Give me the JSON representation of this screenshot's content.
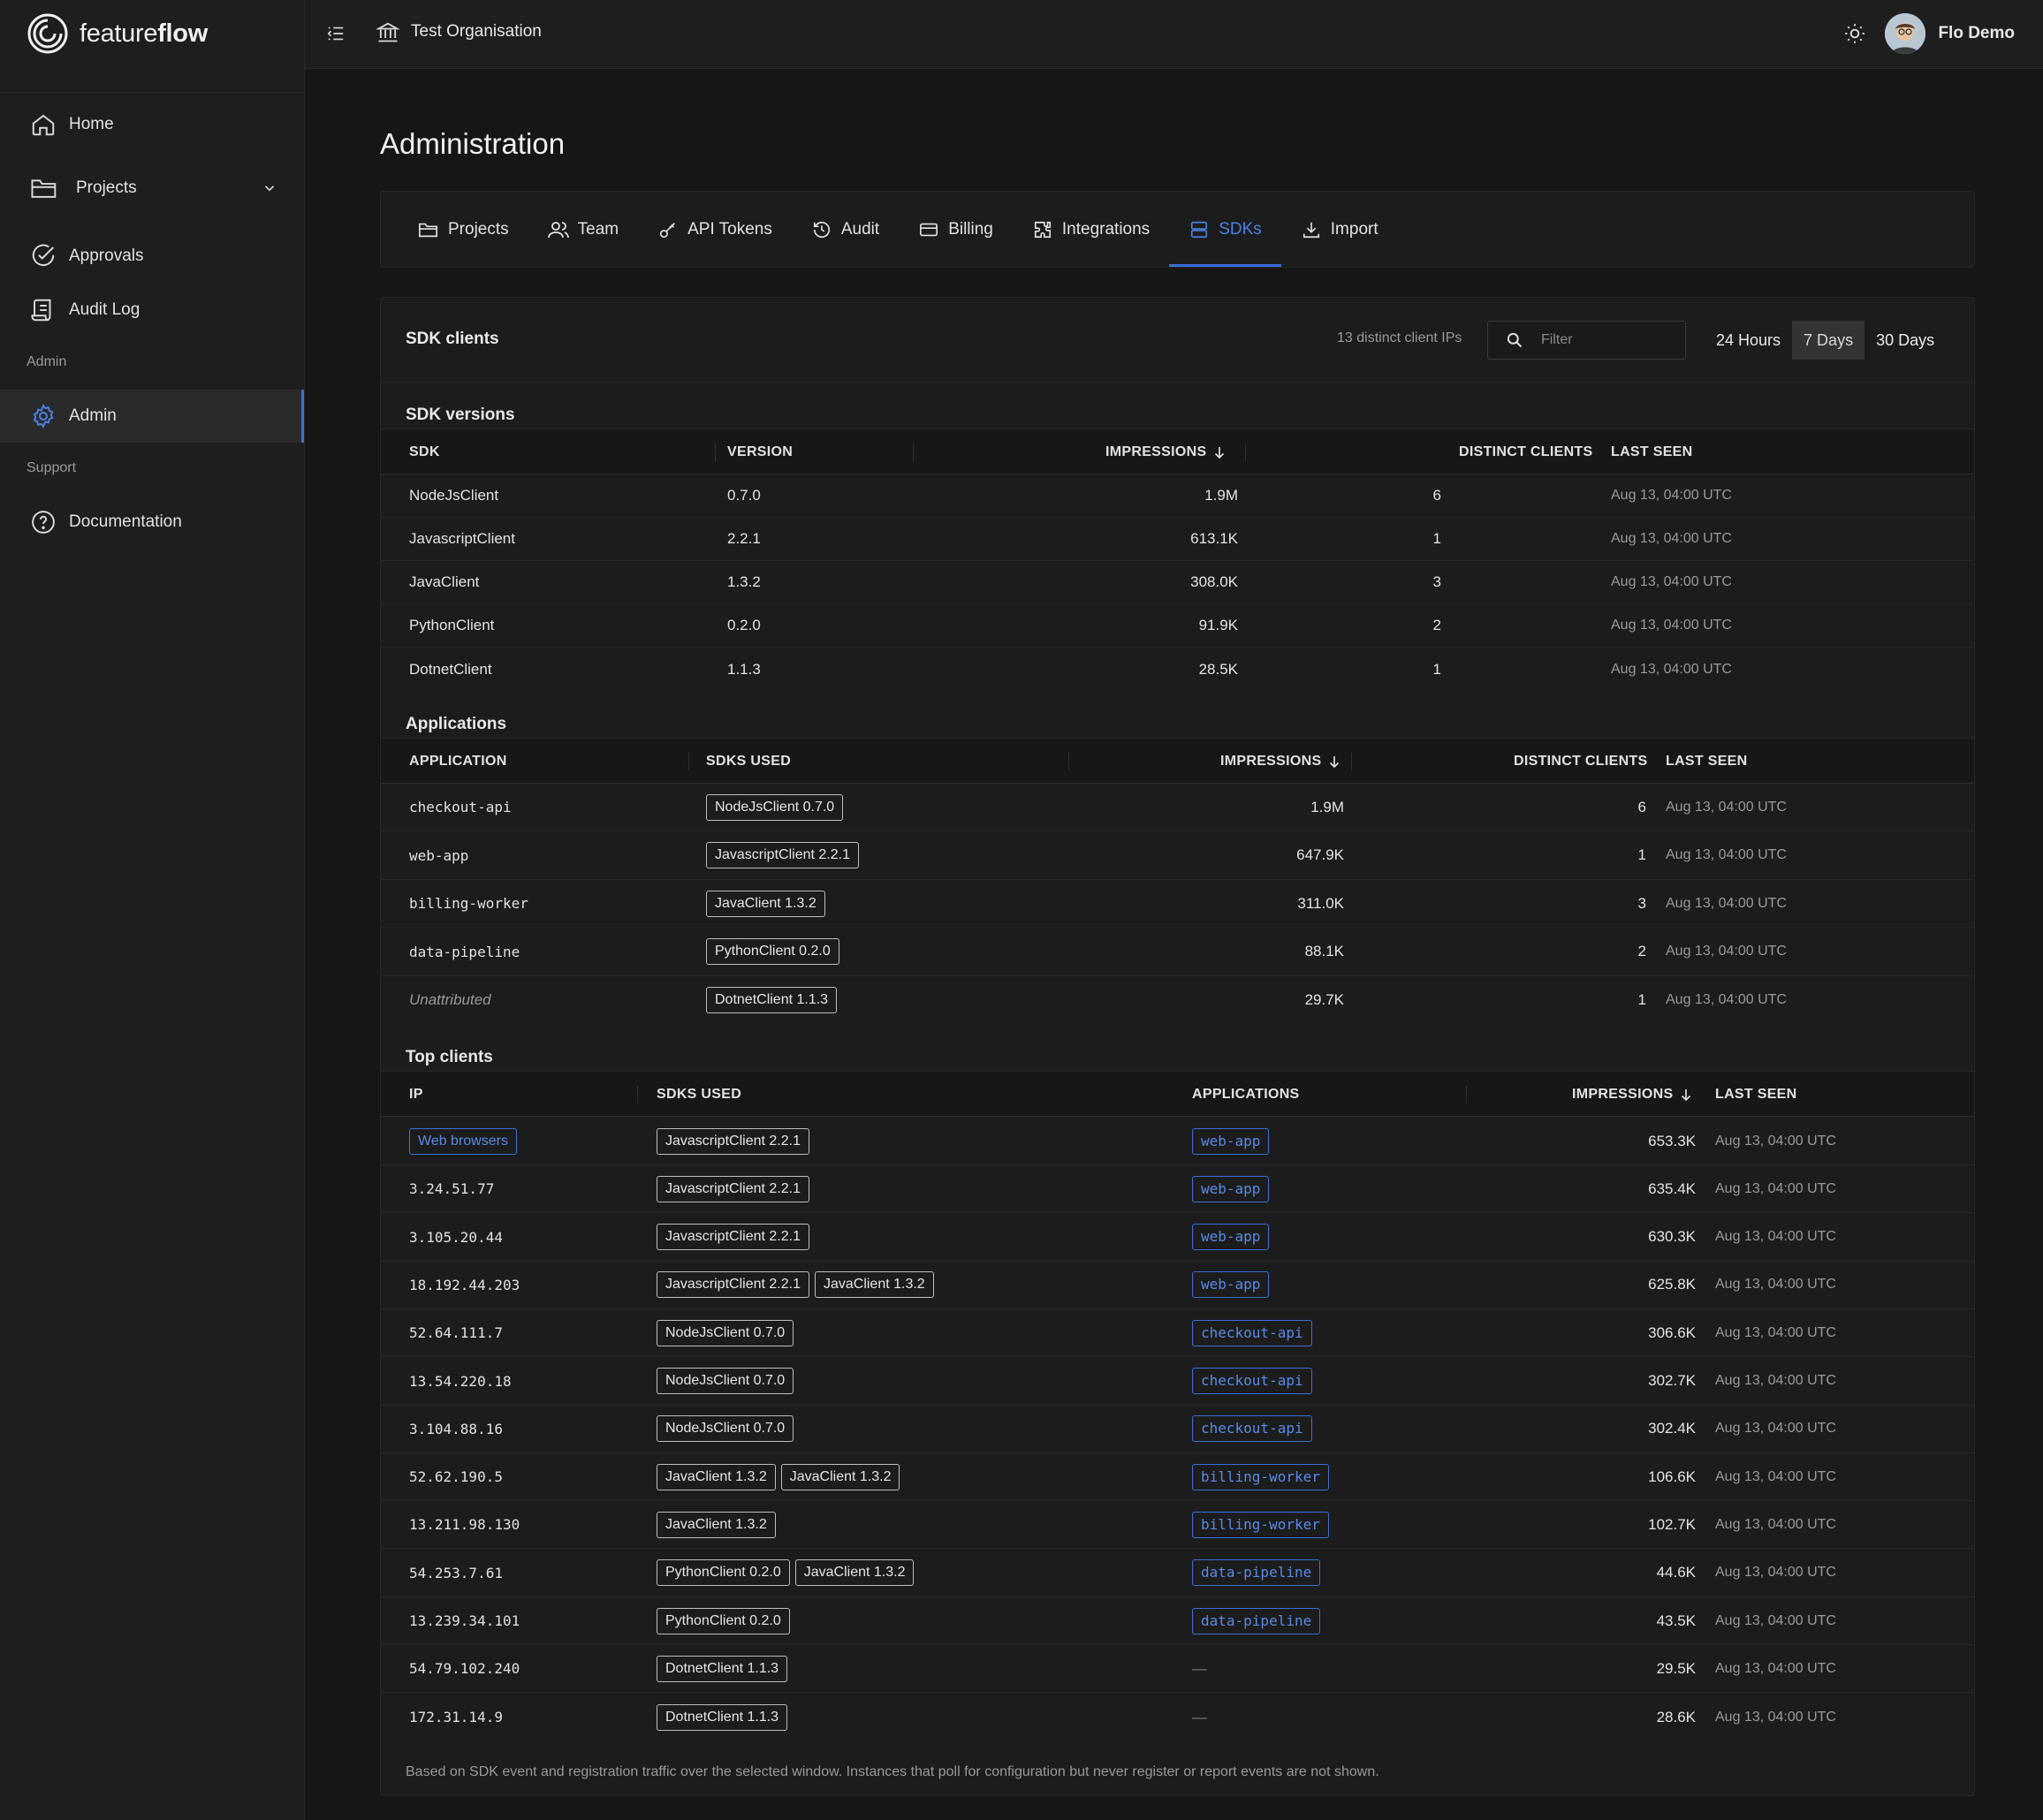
{
  "brand": {
    "light": "feature",
    "bold": "flow"
  },
  "sidebar": {
    "items": [
      {
        "label": "Home"
      },
      {
        "label": "Projects"
      },
      {
        "label": "Approvals"
      },
      {
        "label": "Audit Log"
      }
    ],
    "sections": [
      {
        "label": "Admin",
        "items": [
          {
            "label": "Admin"
          }
        ]
      },
      {
        "label": "Support",
        "items": [
          {
            "label": "Documentation"
          }
        ]
      }
    ]
  },
  "topbar": {
    "org": "Test Organisation",
    "user": "Flo Demo"
  },
  "page": {
    "title": "Administration"
  },
  "tabs": [
    "Projects",
    "Team",
    "API Tokens",
    "Audit",
    "Billing",
    "Integrations",
    "SDKs",
    "Import"
  ],
  "active_tab": "SDKs",
  "card": {
    "title": "SDK clients",
    "distinct_ips": "13 distinct client IPs",
    "filter_placeholder": "Filter",
    "ranges": [
      "24 Hours",
      "7 Days",
      "30 Days"
    ],
    "selected_range": "7 Days"
  },
  "versions": {
    "title": "SDK versions",
    "headers": [
      "SDK",
      "VERSION",
      "IMPRESSIONS",
      "DISTINCT CLIENTS",
      "LAST SEEN"
    ],
    "rows": [
      {
        "sdk": "NodeJsClient",
        "version": "0.7.0",
        "impressions": "1.9M",
        "clients": "6",
        "last_seen": "Aug 13, 04:00 UTC"
      },
      {
        "sdk": "JavascriptClient",
        "version": "2.2.1",
        "impressions": "613.1K",
        "clients": "1",
        "last_seen": "Aug 13, 04:00 UTC"
      },
      {
        "sdk": "JavaClient",
        "version": "1.3.2",
        "impressions": "308.0K",
        "clients": "3",
        "last_seen": "Aug 13, 04:00 UTC"
      },
      {
        "sdk": "PythonClient",
        "version": "0.2.0",
        "impressions": "91.9K",
        "clients": "2",
        "last_seen": "Aug 13, 04:00 UTC"
      },
      {
        "sdk": "DotnetClient",
        "version": "1.1.3",
        "impressions": "28.5K",
        "clients": "1",
        "last_seen": "Aug 13, 04:00 UTC"
      }
    ]
  },
  "applications": {
    "title": "Applications",
    "headers": [
      "APPLICATION",
      "SDKS USED",
      "IMPRESSIONS",
      "DISTINCT CLIENTS",
      "LAST SEEN"
    ],
    "rows": [
      {
        "app": "checkout-api",
        "sdk": "NodeJsClient 0.7.0",
        "impressions": "1.9M",
        "clients": "6",
        "last_seen": "Aug 13, 04:00 UTC"
      },
      {
        "app": "web-app",
        "sdk": "JavascriptClient 2.2.1",
        "impressions": "647.9K",
        "clients": "1",
        "last_seen": "Aug 13, 04:00 UTC"
      },
      {
        "app": "billing-worker",
        "sdk": "JavaClient 1.3.2",
        "impressions": "311.0K",
        "clients": "3",
        "last_seen": "Aug 13, 04:00 UTC"
      },
      {
        "app": "data-pipeline",
        "sdk": "PythonClient 0.2.0",
        "impressions": "88.1K",
        "clients": "2",
        "last_seen": "Aug 13, 04:00 UTC"
      },
      {
        "app": "Unattributed",
        "sdk": "DotnetClient 1.1.3",
        "impressions": "29.7K",
        "clients": "1",
        "last_seen": "Aug 13, 04:00 UTC",
        "unattributed": true
      }
    ]
  },
  "top_clients": {
    "title": "Top clients",
    "headers": [
      "IP",
      "SDKS USED",
      "APPLICATIONS",
      "IMPRESSIONS",
      "LAST SEEN"
    ],
    "rows": [
      {
        "ip": "Web browsers",
        "ip_badge": true,
        "sdks": [
          "JavascriptClient 2.2.1"
        ],
        "app": "web-app",
        "impressions": "653.3K",
        "last_seen": "Aug 13, 04:00 UTC"
      },
      {
        "ip": "3.24.51.77",
        "sdks": [
          "JavascriptClient 2.2.1"
        ],
        "app": "web-app",
        "impressions": "635.4K",
        "last_seen": "Aug 13, 04:00 UTC"
      },
      {
        "ip": "3.105.20.44",
        "sdks": [
          "JavascriptClient 2.2.1"
        ],
        "app": "web-app",
        "impressions": "630.3K",
        "last_seen": "Aug 13, 04:00 UTC"
      },
      {
        "ip": "18.192.44.203",
        "sdks": [
          "JavascriptClient 2.2.1",
          "JavaClient 1.3.2"
        ],
        "app": "web-app",
        "impressions": "625.8K",
        "last_seen": "Aug 13, 04:00 UTC"
      },
      {
        "ip": "52.64.111.7",
        "sdks": [
          "NodeJsClient 0.7.0"
        ],
        "app": "checkout-api",
        "impressions": "306.6K",
        "last_seen": "Aug 13, 04:00 UTC"
      },
      {
        "ip": "13.54.220.18",
        "sdks": [
          "NodeJsClient 0.7.0"
        ],
        "app": "checkout-api",
        "impressions": "302.7K",
        "last_seen": "Aug 13, 04:00 UTC"
      },
      {
        "ip": "3.104.88.16",
        "sdks": [
          "NodeJsClient 0.7.0"
        ],
        "app": "checkout-api",
        "impressions": "302.4K",
        "last_seen": "Aug 13, 04:00 UTC"
      },
      {
        "ip": "52.62.190.5",
        "sdks": [
          "JavaClient 1.3.2",
          "JavaClient 1.3.2"
        ],
        "app": "billing-worker",
        "impressions": "106.6K",
        "last_seen": "Aug 13, 04:00 UTC"
      },
      {
        "ip": "13.211.98.130",
        "sdks": [
          "JavaClient 1.3.2"
        ],
        "app": "billing-worker",
        "impressions": "102.7K",
        "last_seen": "Aug 13, 04:00 UTC"
      },
      {
        "ip": "54.253.7.61",
        "sdks": [
          "PythonClient 0.2.0",
          "JavaClient 1.3.2"
        ],
        "app": "data-pipeline",
        "impressions": "44.6K",
        "last_seen": "Aug 13, 04:00 UTC"
      },
      {
        "ip": "13.239.34.101",
        "sdks": [
          "PythonClient 0.2.0"
        ],
        "app": "data-pipeline",
        "impressions": "43.5K",
        "last_seen": "Aug 13, 04:00 UTC"
      },
      {
        "ip": "54.79.102.240",
        "sdks": [
          "DotnetClient 1.1.3"
        ],
        "app": "—",
        "impressions": "29.5K",
        "last_seen": "Aug 13, 04:00 UTC"
      },
      {
        "ip": "172.31.14.9",
        "sdks": [
          "DotnetClient 1.1.3"
        ],
        "app": "—",
        "impressions": "28.6K",
        "last_seen": "Aug 13, 04:00 UTC"
      }
    ]
  },
  "footnote": "Based on SDK event and registration traffic over the selected window. Instances that poll for configuration but never register or report events are not shown.",
  "colors": {
    "accent": "#3b6fd8",
    "background": "#161616",
    "panel": "#1e1e1e"
  }
}
